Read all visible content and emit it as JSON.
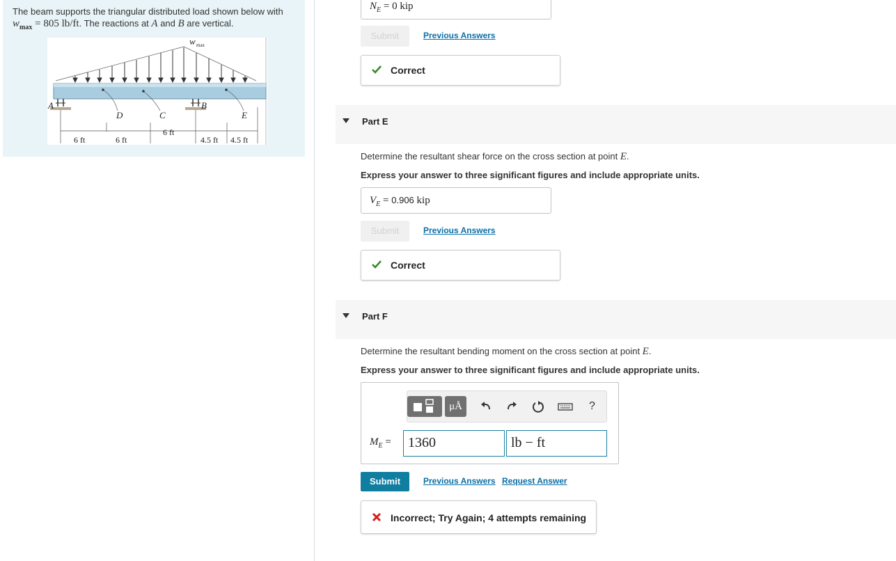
{
  "problem": {
    "text_before": "The beam supports the triangular distributed load shown below with",
    "wmax_symbol": "w",
    "wmax_sub": "max",
    "wmax_value": "= 805 lb/ft",
    "text_after_1": ". The reactions at ",
    "point_a": "A",
    "text_and": " and ",
    "point_b": "B",
    "text_after_2": " are vertical.",
    "figure": {
      "load_label": "w",
      "load_label_sub": "max",
      "point_labels": [
        "A",
        "D",
        "C",
        "B",
        "E"
      ],
      "dimensions": [
        "6 ft",
        "6 ft",
        "6 ft",
        "4.5 ft",
        "4.5 ft"
      ]
    }
  },
  "part_d_tail": {
    "answer_symbol": "N",
    "answer_sub": "E",
    "answer_value": "= 0 kip",
    "submit_label": "Submit",
    "previous_answers_label": "Previous Answers",
    "feedback_label": "Correct"
  },
  "part_e": {
    "title": "Part E",
    "question_prefix": "Determine the resultant shear force on the cross section at point ",
    "question_point": "E",
    "question_suffix": ".",
    "instruction": "Express your answer to three significant figures and include appropriate units.",
    "answer_symbol": "V",
    "answer_sub": "E",
    "answer_eq": "=",
    "answer_number": "0.906",
    "answer_unit": "kip",
    "submit_label": "Submit",
    "previous_answers_label": "Previous Answers",
    "feedback_label": "Correct"
  },
  "part_f": {
    "title": "Part F",
    "question_prefix": "Determine the resultant bending moment on the cross section at point ",
    "question_point": "E",
    "question_suffix": ".",
    "instruction": "Express your answer to three significant figures and include appropriate units.",
    "toolbar": {
      "units_button_label": "μÅ",
      "help_label": "?",
      "icons": [
        "templates-icon",
        "units-icon",
        "undo-icon",
        "redo-icon",
        "reset-icon",
        "keyboard-icon",
        "help-icon"
      ]
    },
    "answer_symbol": "M",
    "answer_sub": "E",
    "answer_eq": "=",
    "value": "1360",
    "units": "lb − ft",
    "submit_label": "Submit",
    "previous_answers_label": "Previous Answers",
    "request_answer_label": "Request Answer",
    "feedback_label": "Incorrect; Try Again; 4 attempts remaining"
  },
  "colors": {
    "correct": "#3a8a2a",
    "incorrect": "#d11f1f",
    "accent": "#0f7ea0",
    "problem_bg": "#e8f4f7"
  }
}
